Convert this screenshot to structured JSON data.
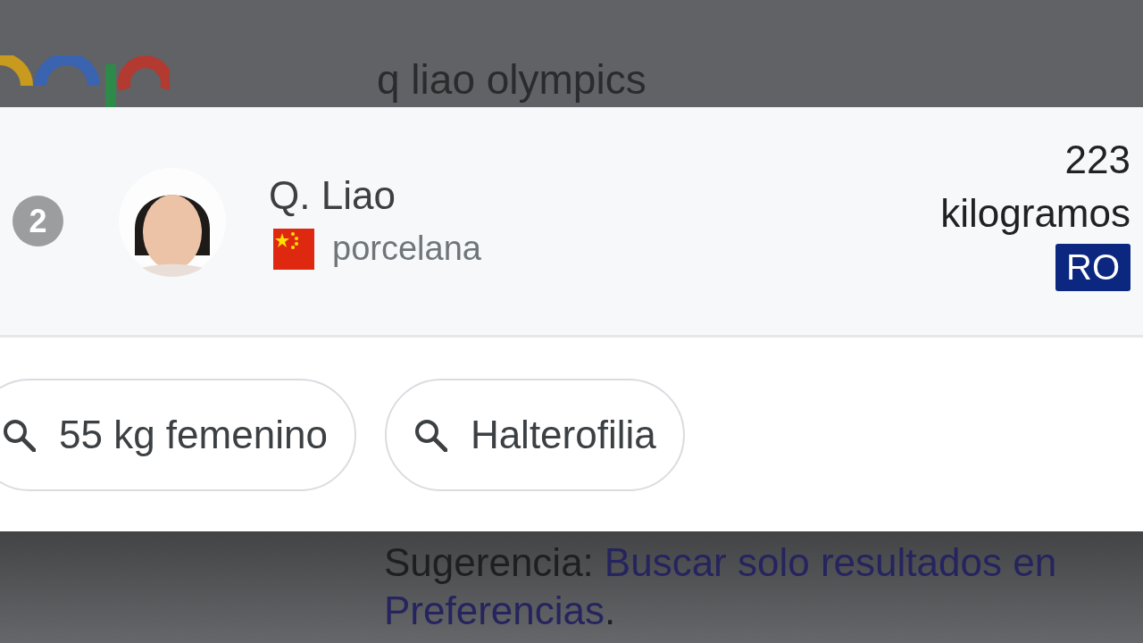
{
  "search_bar": {
    "query": "q liao olympics"
  },
  "result": {
    "rank": "2",
    "name": "Q. Liao",
    "country": "porcelana",
    "score": "223",
    "unit": "kilogramos",
    "badge": "RO"
  },
  "related_searches": [
    {
      "label": "55 kg femenino"
    },
    {
      "label": "Halterofilia"
    }
  ],
  "tip": {
    "label": "Sugerencia:",
    "link": "Buscar solo resultados en",
    "link_2": "Preferencias",
    "end": "."
  }
}
